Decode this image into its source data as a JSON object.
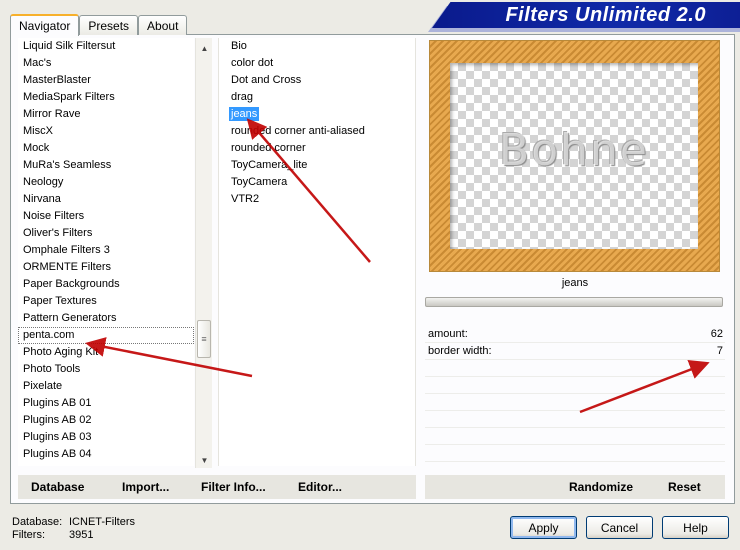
{
  "title": "Filters Unlimited 2.0",
  "tabs": [
    {
      "label": "Navigator",
      "active": true
    },
    {
      "label": "Presets",
      "active": false
    },
    {
      "label": "About",
      "active": false
    }
  ],
  "categories": [
    "Liquid Silk Filtersut",
    "Mac's",
    "MasterBlaster",
    "MediaSpark Filters",
    "Mirror Rave",
    "MiscX",
    "Mock",
    "MuRa's Seamless",
    "Neology",
    "Nirvana",
    "Noise Filters",
    "Oliver's Filters",
    "Omphale Filters 3",
    "ORMENTE Filters",
    "Paper Backgrounds",
    "Paper Textures",
    "Pattern Generators",
    "penta.com",
    "Photo Aging Kit",
    "Photo Tools",
    "Pixelate",
    "Plugins AB 01",
    "Plugins AB 02",
    "Plugins AB 03",
    "Plugins AB 04"
  ],
  "filters": [
    "Bio",
    "color dot",
    "Dot and Cross",
    "drag",
    "jeans",
    "rounded corner anti-aliased",
    "rounded corner",
    "ToyCamera_lite",
    "ToyCamera",
    "VTR2"
  ],
  "selected_filter": "jeans",
  "preview": {
    "watermark": "Bohne"
  },
  "filter_name_label": "jeans",
  "params": [
    {
      "label": "amount:",
      "value": "62"
    },
    {
      "label": "border width:",
      "value": "7"
    }
  ],
  "buttons": {
    "database": "Database",
    "import": "Import...",
    "filter_info": "Filter Info...",
    "editor": "Editor...",
    "randomize": "Randomize",
    "reset": "Reset",
    "apply": "Apply",
    "cancel": "Cancel",
    "help": "Help"
  },
  "footer": {
    "database_label": "Database:",
    "database_value": "ICNET-Filters",
    "filters_label": "Filters:",
    "filters_value": "3951"
  },
  "colors": {
    "banner": "#0a1a8c",
    "selection": "#3399ff",
    "arrow": "#c00000"
  }
}
